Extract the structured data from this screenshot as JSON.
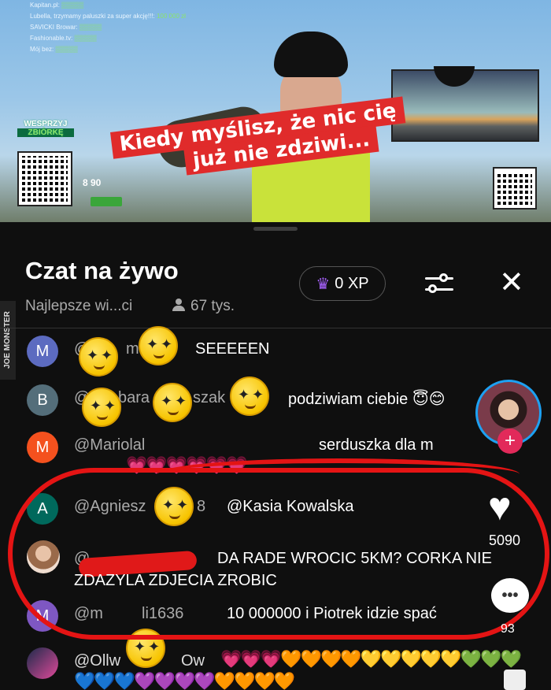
{
  "stream": {
    "donations": [
      {
        "name": "Kapitan.pl",
        "amount": "▒▒▒▒▒"
      },
      {
        "name": "Lubella, trzymamy paluszki za super akcję!!!",
        "amount": "100 000 zł"
      },
      {
        "name": "SAVICKI Browar",
        "amount": "▒▒▒▒▒"
      },
      {
        "name": "Fashionable.tv",
        "amount": "▒▒▒▒▒"
      },
      {
        "name": "Mój bez",
        "amount": "▒▒▒▒▒"
      }
    ],
    "support_label_1": "WESPRZYJ",
    "support_label_2": "ZBIÓRKĘ",
    "goal_amount": "8 90",
    "caption_line1": "Kiedy myślisz, że nic cię",
    "caption_line2": "już nie zdziwi..."
  },
  "chat": {
    "title": "Czat na żywo",
    "subtitle": "Najlepsze wi...ci",
    "viewers": "67 tys.",
    "xp": "0 XP",
    "close_symbol": "✕",
    "watermark": "JOE MONSTER",
    "messages": [
      {
        "initial": "M",
        "color": "#5c6bc0",
        "author": "@",
        "suffix": "m",
        "text": "SEEEEEN"
      },
      {
        "initial": "B",
        "color": "#546e7a",
        "author": "@",
        "suffix": "bara",
        "suffix2": "szak",
        "text": "podziwiam ciebie 😇😊"
      },
      {
        "initial": "M",
        "color": "#f4511e",
        "author": "@Mariolal",
        "text": "serduszka dla m",
        "hearts": "💗💗💗💗💗💗"
      },
      {
        "initial": "A",
        "color": "#00695c",
        "author": "@Agniesz",
        "suffix": "8",
        "text": "@Kasia Kowalska"
      },
      {
        "author": "@",
        "text": "DA RADE WROCIC 5KM? CORKA NIE",
        "text2": "ZDAZYLA ZDJECIA ZROBIC"
      },
      {
        "initial": "M",
        "color": "#7e57c2",
        "author": "@m",
        "suffix": "li1636",
        "text": "10 000000 i Piotrek idzie spać"
      },
      {
        "author": "@Ollw",
        "suffix": "Ow",
        "hearts": "💗💗💗🧡🧡🧡🧡💛💛💛💛💛💚💚💚",
        "hearts2": "💙💙💙💜💜💜💜🧡🧡🧡🧡"
      }
    ],
    "like_count": "5090",
    "comment_count": "93"
  }
}
